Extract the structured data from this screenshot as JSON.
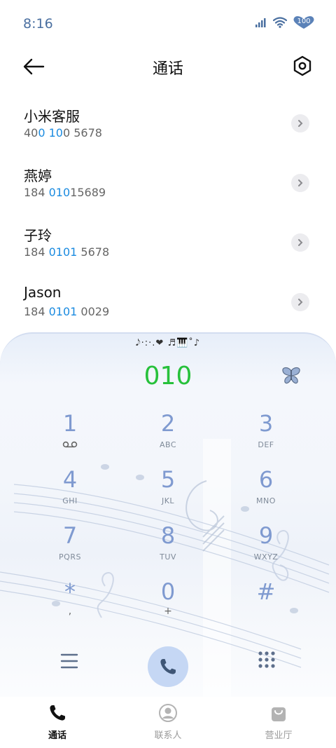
{
  "status_bar": {
    "time": "8:16",
    "battery": "100",
    "icons": [
      "signal-icon",
      "wifi-icon",
      "battery-icon"
    ]
  },
  "header": {
    "title": "通话",
    "back_icon": "back-arrow-icon",
    "settings_icon": "settings-icon"
  },
  "recent_calls": [
    {
      "name": "小米客服",
      "number_parts": [
        "40",
        "0 10",
        "0 5678"
      ]
    },
    {
      "name": "燕婷",
      "number_parts": [
        "184 ",
        "010",
        "15689"
      ]
    },
    {
      "name": "子玲",
      "number_parts": [
        "184 ",
        "0101",
        " 5678"
      ]
    },
    {
      "name": "Jason",
      "number_parts": [
        "184 ",
        "0101",
        " 0029"
      ]
    }
  ],
  "dialer": {
    "notes_text": "𝅘𝅥𝅮·:·.❤ ♬🎹˚♪",
    "input_value": "010",
    "input_color": "#27c13b",
    "keys": [
      {
        "digit": "1",
        "letters": "",
        "icon": "voicemail-icon"
      },
      {
        "digit": "2",
        "letters": "ABC"
      },
      {
        "digit": "3",
        "letters": "DEF"
      },
      {
        "digit": "4",
        "letters": "GHI"
      },
      {
        "digit": "5",
        "letters": "JKL"
      },
      {
        "digit": "6",
        "letters": "MNO"
      },
      {
        "digit": "7",
        "letters": "PQRS"
      },
      {
        "digit": "8",
        "letters": "TUV"
      },
      {
        "digit": "9",
        "letters": "WXYZ"
      },
      {
        "digit": "*",
        "letters": ","
      },
      {
        "digit": "0",
        "letters": "+"
      },
      {
        "digit": "#",
        "letters": ""
      }
    ]
  },
  "bottom_nav": {
    "items": [
      {
        "label": "通话",
        "icon": "phone-icon",
        "active": true
      },
      {
        "label": "联系人",
        "icon": "contacts-icon",
        "active": false
      },
      {
        "label": "营业厅",
        "icon": "store-bag-icon",
        "active": false
      }
    ]
  },
  "colors": {
    "accent": "#1b8be0",
    "key_digit": "#7f9ad0",
    "call_button": "#c5d7f4"
  }
}
